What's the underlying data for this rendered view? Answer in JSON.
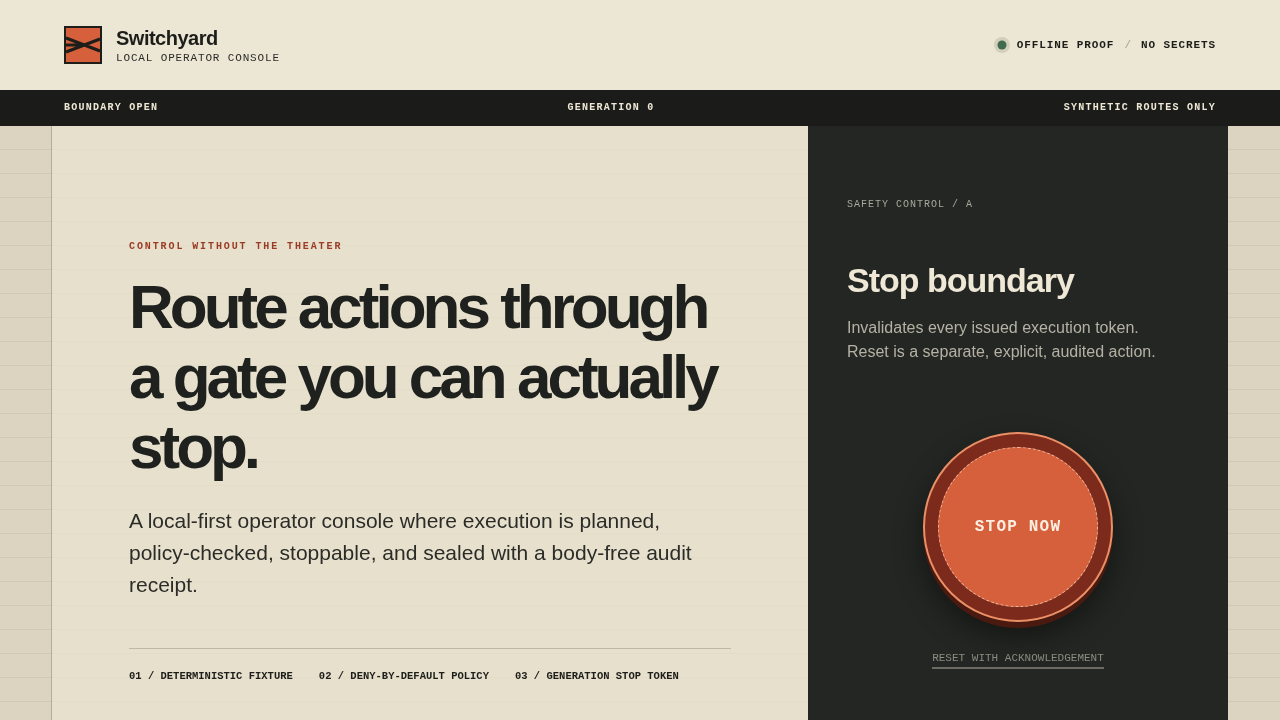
{
  "header": {
    "brand": "Switchyard",
    "tagline": "LOCAL OPERATOR CONSOLE",
    "badges": [
      "OFFLINE PROOF",
      "NO SECRETS"
    ],
    "badge_separator": "/"
  },
  "status_bar": [
    "BOUNDARY OPEN",
    "GENERATION 0",
    "SYNTHETIC ROUTES ONLY"
  ],
  "hero": {
    "eyebrow": "CONTROL WITHOUT THE THEATER",
    "headline": "Route actions through a gate you can actually stop.",
    "description": "A local-first operator console where execution is planned, policy-checked, stoppable, and sealed with a body-free audit receipt.",
    "features": [
      "01 / DETERMINISTIC FIXTURE",
      "02 / DENY-BY-DEFAULT POLICY",
      "03 / GENERATION STOP TOKEN"
    ]
  },
  "safety_panel": {
    "eyebrow": "SAFETY CONTROL / A",
    "title": "Stop boundary",
    "description": "Invalidates every issued execution token. Reset is a separate, explicit, audited action.",
    "stop_button": "STOP NOW",
    "reset_link": "RESET WITH ACKNOWLEDGEMENT"
  }
}
